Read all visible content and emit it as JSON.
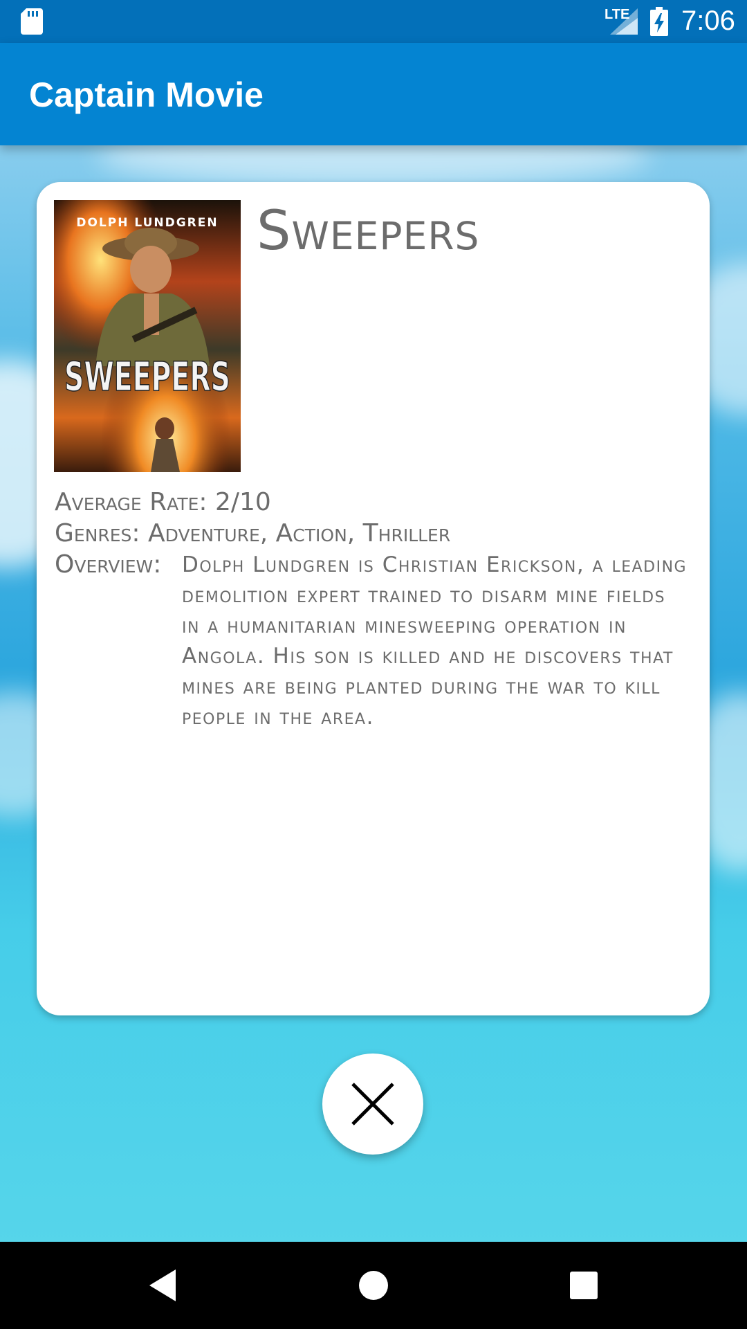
{
  "status_bar": {
    "network": "LTE",
    "time": "7:06",
    "icons": [
      "sd-card-icon",
      "signal-icon",
      "battery-charging-icon"
    ]
  },
  "app_bar": {
    "title": "Captain Movie"
  },
  "movie": {
    "title": "Sweepers",
    "poster": {
      "actor": "DOLPH LUNDGREN",
      "title": "SWEEPERS"
    },
    "average_rate_label": "Average Rate:",
    "average_rate": "2/10",
    "genres_label": "Genres:",
    "genres": "Adventure, Action, Thriller",
    "overview_label": "Overview:",
    "overview": "Dolph Lundgren is Christian Erickson, a leading demolition expert trained to disarm mine fields in a humanitarian minesweeping operation in Angola. His son is killed and he discovers that mines are being planted during the war to kill people in the area."
  },
  "actions": {
    "close_icon": "close-icon"
  },
  "nav_bar": {
    "icons": [
      "back-icon",
      "home-icon",
      "recents-icon"
    ]
  },
  "colors": {
    "status_bar": "#0370b9",
    "app_bar": "#0484d2",
    "text_gray": "#6c6c6c"
  }
}
